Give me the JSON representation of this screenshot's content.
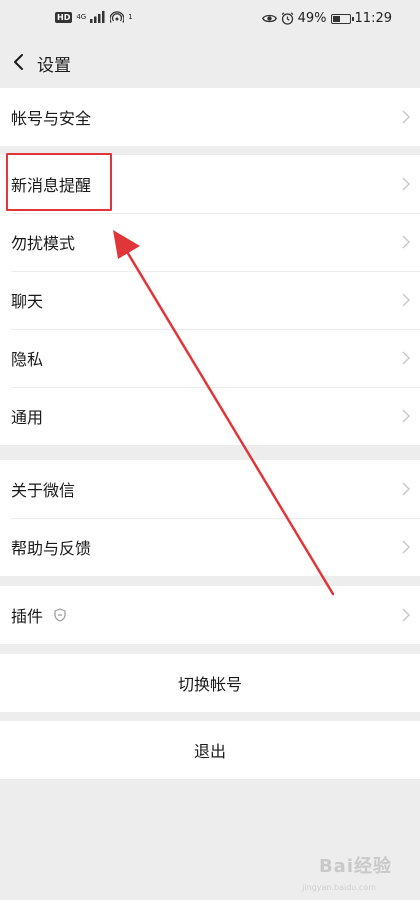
{
  "status_bar": {
    "hd": "HD",
    "network": "4G",
    "alarm_badge": "1",
    "battery_text": "49%",
    "battery_level": 0.49,
    "time": "11:29"
  },
  "nav": {
    "title": "设置"
  },
  "groups": {
    "account": {
      "items": [
        {
          "label": "帐号与安全"
        }
      ]
    },
    "main": {
      "items": [
        {
          "label": "新消息提醒"
        },
        {
          "label": "勿扰模式"
        },
        {
          "label": "聊天"
        },
        {
          "label": "隐私"
        },
        {
          "label": "通用"
        }
      ]
    },
    "about": {
      "items": [
        {
          "label": "关于微信"
        },
        {
          "label": "帮助与反馈"
        }
      ]
    },
    "plugins": {
      "items": [
        {
          "label": "插件"
        }
      ]
    }
  },
  "buttons": {
    "switch_account": "切换帐号",
    "logout": "退出"
  },
  "watermark": {
    "text": "Bai经验",
    "sub": "jingyan.baidu.com"
  },
  "colors": {
    "annotation": "#e0363a",
    "background": "#ededed",
    "card": "#ffffff"
  },
  "icons": [
    "back-icon",
    "chevron-right-icon",
    "shield-icon",
    "eye-icon",
    "alarm-icon",
    "signal-icon",
    "battery-icon",
    "arrow-annotation"
  ]
}
